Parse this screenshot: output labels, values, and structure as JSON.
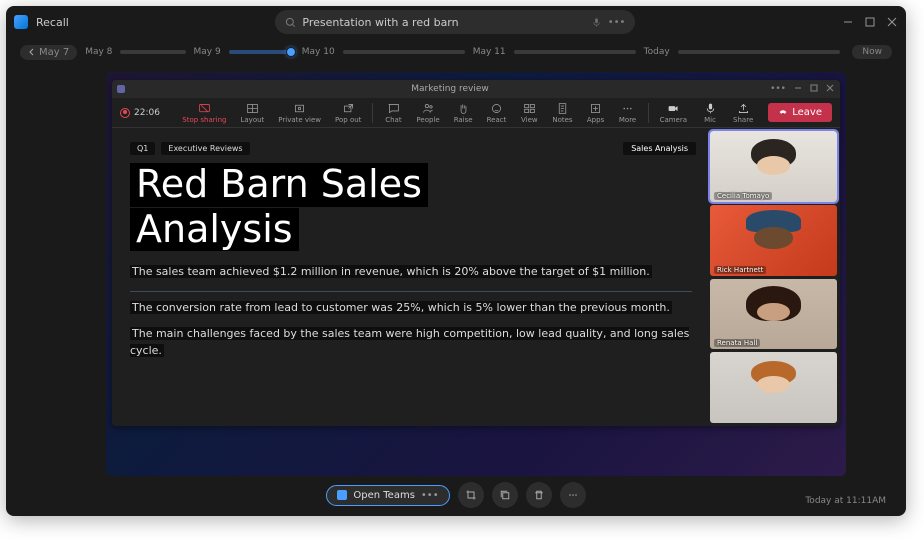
{
  "app": {
    "name": "Recall"
  },
  "search": {
    "value": "Presentation with a red barn",
    "placeholder": "Search"
  },
  "timeline": {
    "nav_label": "May 7",
    "dates": [
      "May 8",
      "May 9",
      "May 10",
      "May 11",
      "Today"
    ],
    "now_label": "Now"
  },
  "teams": {
    "title": "Marketing review",
    "rec_time": "22:06",
    "menu": {
      "stop_sharing": "Stop sharing",
      "layout": "Layout",
      "private_view": "Private view",
      "pop_out": "Pop out",
      "chat": "Chat",
      "people": "People",
      "raise": "Raise",
      "react": "React",
      "view": "View",
      "notes": "Notes",
      "apps": "Apps",
      "more": "More",
      "camera": "Camera",
      "mic": "Mic",
      "share": "Share",
      "leave": "Leave"
    },
    "slide": {
      "tag1": "Q1",
      "tag2": "Executive Reviews",
      "badge": "Sales Analysis",
      "title_l1": "Red Barn Sales",
      "title_l2": "Analysis",
      "p1": "The sales team achieved $1.2 million in revenue, which is 20% above the target of $1 million.",
      "p2": "The conversion rate from lead to customer was 25%, which is 5% lower than the previous month.",
      "p3": "The main challenges faced by the sales team were high competition, low lead quality, and long sales cycle."
    },
    "participants": [
      {
        "name": "Cecilia Tomayo"
      },
      {
        "name": "Rick Hartnett"
      },
      {
        "name": "Renata Hall"
      },
      {
        "name": ""
      }
    ]
  },
  "actions": {
    "open_app": "Open Teams"
  },
  "footer": {
    "timestamp": "Today at 11:11AM"
  }
}
